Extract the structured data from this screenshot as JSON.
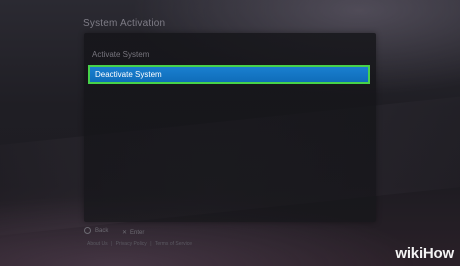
{
  "screen": {
    "title": "System Activation"
  },
  "menu": {
    "items": [
      {
        "label": "Activate System"
      },
      {
        "label": "Deactivate System",
        "selected": true
      }
    ]
  },
  "footer": {
    "back_icon": "circle-icon",
    "back_label": "Back",
    "enter_icon": "cross-icon",
    "enter_label": "Enter",
    "links": {
      "accent": "",
      "about": "About Us",
      "privacy": "Privacy Policy",
      "terms": "Terms of Service"
    }
  },
  "watermark": {
    "part1": "wiki",
    "part2": "How"
  },
  "colors": {
    "selection": "#0f6db9",
    "highlight_border": "#47d24b"
  }
}
